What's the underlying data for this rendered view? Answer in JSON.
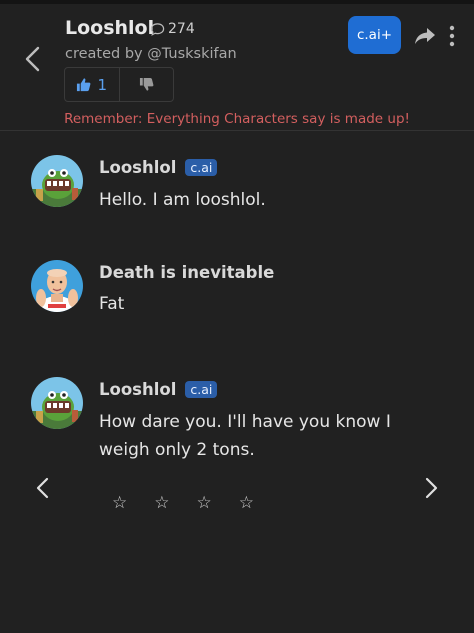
{
  "header": {
    "title": "Looshlol",
    "chat_count": "274",
    "creator": "created by @Tuskskifan",
    "likes": "1",
    "cai_plus_label": "c.ai+"
  },
  "disclaimer": "Remember: Everything Characters say is made up!",
  "messages": [
    {
      "sender": "Looshlol",
      "badge": "c.ai",
      "text": "Hello. I am looshlol."
    },
    {
      "sender": "Death is inevitable",
      "badge": "",
      "text": "Fat"
    },
    {
      "sender": "Looshlol",
      "badge": "c.ai",
      "text": "How dare you. I'll have you know I weigh only 2 tons."
    }
  ],
  "rating": {
    "stars": [
      "☆",
      "☆",
      "☆",
      "☆"
    ]
  },
  "icons": {
    "back": "chevron-left-icon",
    "chat": "speech-bubble-icon",
    "like": "thumbs-up-icon",
    "dislike": "thumbs-down-icon",
    "share": "share-arrow-icon",
    "more": "more-vertical-icon",
    "prev": "chevron-left-icon",
    "next": "chevron-right-icon"
  },
  "colors": {
    "background": "#212121",
    "accent": "#1f6dd3",
    "badge": "#2b5ea8",
    "warning": "#d35f5f",
    "like": "#5aa0ef"
  }
}
